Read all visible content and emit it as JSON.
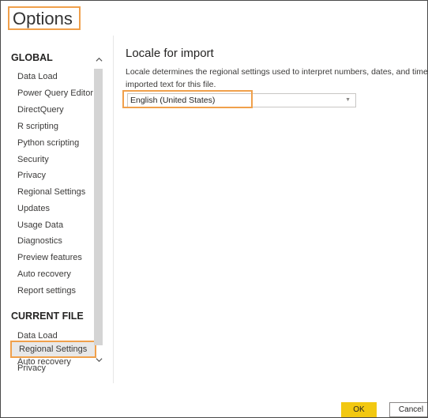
{
  "window": {
    "title": "Options"
  },
  "sidebar": {
    "global_header": "GLOBAL",
    "global_items": [
      {
        "label": "Data Load"
      },
      {
        "label": "Power Query Editor"
      },
      {
        "label": "DirectQuery"
      },
      {
        "label": "R scripting"
      },
      {
        "label": "Python scripting"
      },
      {
        "label": "Security"
      },
      {
        "label": "Privacy"
      },
      {
        "label": "Regional Settings"
      },
      {
        "label": "Updates"
      },
      {
        "label": "Usage Data"
      },
      {
        "label": "Diagnostics"
      },
      {
        "label": "Preview features"
      },
      {
        "label": "Auto recovery"
      },
      {
        "label": "Report settings"
      }
    ],
    "current_file_header": "CURRENT FILE",
    "current_file_items": [
      {
        "label": "Data Load"
      },
      {
        "label": "Regional Settings",
        "selected": true
      },
      {
        "label": "Privacy"
      },
      {
        "label": "Auto recovery"
      }
    ]
  },
  "content": {
    "title": "Locale for import",
    "description": "Locale determines the regional settings used to interpret numbers, dates, and time in imported text for this file.",
    "locale_select": {
      "value": "English (United States)"
    }
  },
  "footer": {
    "ok_label": "OK",
    "cancel_label": "Cancel"
  },
  "colors": {
    "highlight": "#f0a04b",
    "ok_button": "#f2c811",
    "selected_bg": "#e8e8e8"
  }
}
